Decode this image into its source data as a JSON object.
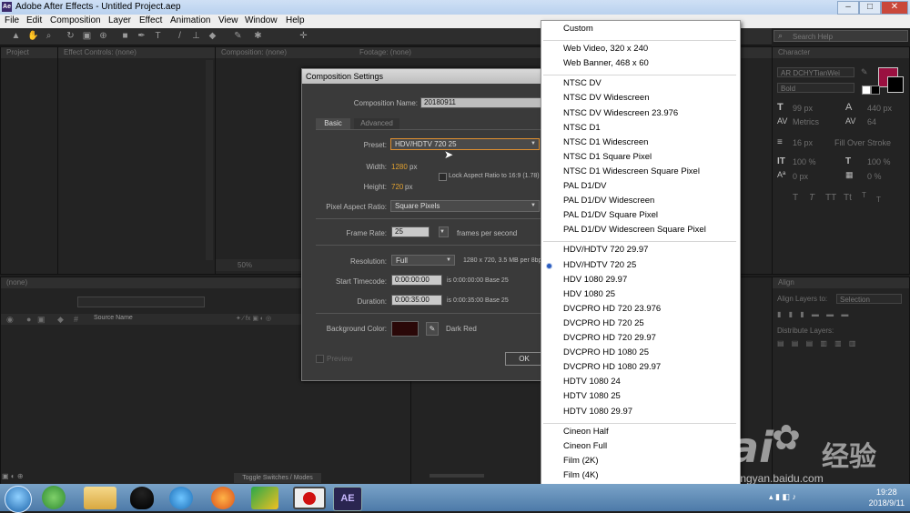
{
  "window": {
    "title": "Adobe After Effects - Untitled Project.aep",
    "app_icon": "Ae"
  },
  "menu": [
    "File",
    "Edit",
    "Composition",
    "Layer",
    "Effect",
    "Animation",
    "View",
    "Window",
    "Help"
  ],
  "search": {
    "placeholder": "Search Help"
  },
  "panels": {
    "project_tab": "Project",
    "effect_controls_tab": "Effect Controls: (none)",
    "composition_tab": "Composition: (none)",
    "footage_tab": "Footage: (none)",
    "character_tab": "Character",
    "align_tab": "Align",
    "timeline_tab": "(none)",
    "zoom": "50%",
    "source_name_header": "Source Name",
    "toggle_switches": "Toggle Switches / Modes"
  },
  "character": {
    "font_family": "AR DCHYTianWei",
    "font_style": "Bold",
    "font_size": "99 px",
    "leading": "440 px",
    "kerning": "Metrics",
    "tracking": "64",
    "stroke_width": "16 px",
    "stroke_type": "Fill Over Stroke",
    "vertical_scale": "100 %",
    "horizontal_scale": "100 %",
    "baseline_shift": "0 px",
    "tsume": "0 %",
    "fill_color": "#9a1040",
    "text_style_buttons": [
      "T",
      "T",
      "TT",
      "Tt",
      "T",
      "T"
    ]
  },
  "align": {
    "align_layers_to_label": "Align Layers to:",
    "align_layers_to_value": "Selection",
    "distribute_label": "Distribute Layers:"
  },
  "dialog": {
    "title": "Composition Settings",
    "comp_name_label": "Composition Name:",
    "comp_name_value": "20180911",
    "tabs": [
      "Basic",
      "Advanced"
    ],
    "preset_label": "Preset:",
    "preset_value": "HDV/HDTV 720 25",
    "width_label": "Width:",
    "width_value": "1280",
    "height_label": "Height:",
    "height_value": "720",
    "px": "px",
    "lock_label": "Lock Aspect Ratio to 16:9 (1.78)",
    "par_label": "Pixel Aspect Ratio:",
    "par_value": "Square Pixels",
    "frame_rate_label": "Frame Rate:",
    "frame_rate_value": "25",
    "frames_per_second": "frames per second",
    "resolution_label": "Resolution:",
    "resolution_value": "Full",
    "resolution_info": "1280 x 720, 3.5 MB per 8bpc",
    "start_timecode_label": "Start Timecode:",
    "start_timecode_value": "0:00:00:00",
    "start_timecode_info": "is 0:00:00:00  Base 25",
    "duration_label": "Duration:",
    "duration_value": "0:00:35:00",
    "duration_info": "is 0:00:35:00  Base 25",
    "bg_color_label": "Background Color:",
    "bg_color_name": "Dark Red",
    "bg_color_hex": "#2a0808",
    "preview_label": "Preview",
    "ok_label": "OK"
  },
  "preset_menu": {
    "groups": [
      [
        "Custom"
      ],
      [
        "Web Video, 320 x 240",
        "Web Banner, 468 x 60"
      ],
      [
        "NTSC DV",
        "NTSC DV Widescreen",
        "NTSC DV Widescreen 23.976",
        "NTSC D1",
        "NTSC D1 Widescreen",
        "NTSC D1 Square Pixel",
        "NTSC D1 Widescreen Square Pixel",
        "PAL D1/DV",
        "PAL D1/DV Widescreen",
        "PAL D1/DV Square Pixel",
        "PAL D1/DV Widescreen Square Pixel"
      ],
      [
        "HDV/HDTV 720 29.97",
        "HDV/HDTV 720 25",
        "HDV 1080 29.97",
        "HDV 1080 25",
        "DVCPRO HD 720 23.976",
        "DVCPRO HD 720 25",
        "DVCPRO HD 720 29.97",
        "DVCPRO HD 1080 25",
        "DVCPRO HD 1080 29.97",
        "HDTV 1080 24",
        "HDTV 1080 25",
        "HDTV 1080 29.97"
      ],
      [
        "Cineon Half",
        "Cineon Full",
        "Film (2K)",
        "Film (4K)"
      ]
    ],
    "selected": "HDV/HDTV 720 25"
  },
  "taskbar": {
    "time": "19:28",
    "date": "2018/9/11",
    "ae_label": "AE"
  },
  "watermark": {
    "brand": "Bai",
    "cn": "经验",
    "url": "jingyan.baidu.com"
  }
}
